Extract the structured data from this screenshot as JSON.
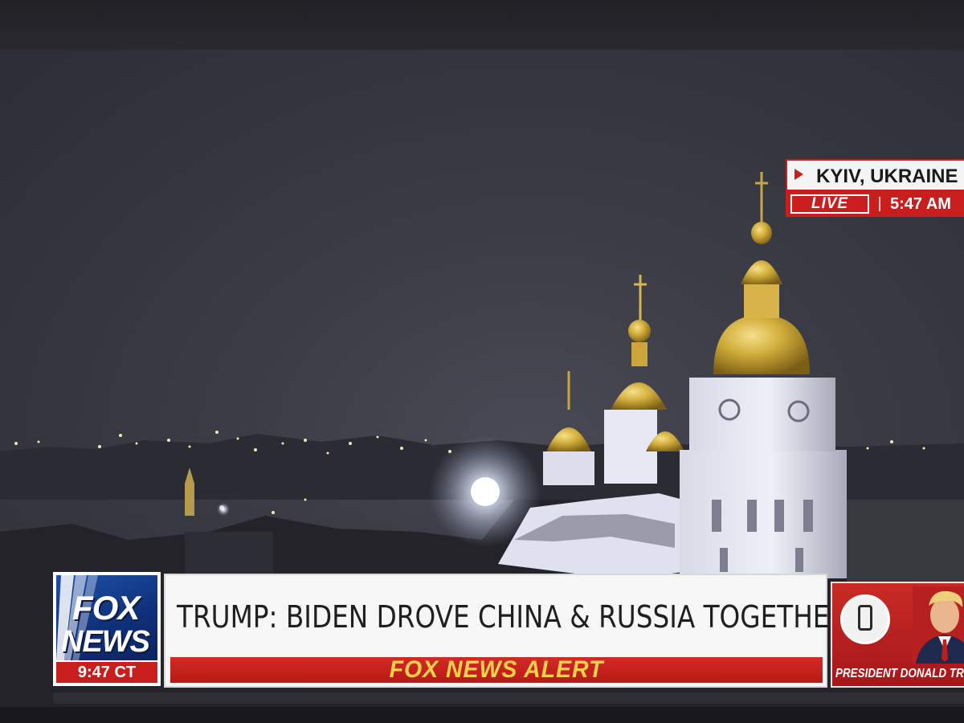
{
  "location_bug": {
    "location": "KYIV, UKRAINE",
    "live": "LIVE",
    "time": "5:47 AM"
  },
  "lower_third": {
    "logo_line1": "FOX",
    "logo_line2": "NEWS",
    "clock": "9:47 CT",
    "headline": "TRUMP: BIDEN DROVE CHINA & RUSSIA TOGETHER",
    "alert": "FOX NEWS ALERT",
    "side_caption": "PRESIDENT DONALD TRUMP"
  },
  "colors": {
    "fox_red": "#c81e1e",
    "fox_blue": "#0e2f78",
    "alert_yellow": "#f5d24a",
    "dome_gold": "#c9a636"
  },
  "icons": [
    "phone-icon"
  ]
}
